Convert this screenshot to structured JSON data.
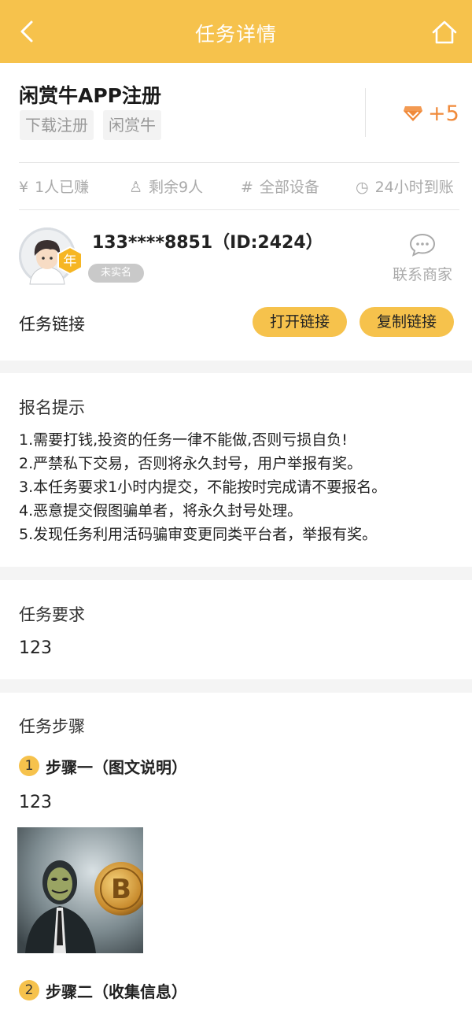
{
  "header": {
    "title": "任务详情",
    "back_icon": "chevron-left-icon",
    "home_icon": "home-icon"
  },
  "task": {
    "title": "闲赏牛APP注册",
    "tags": [
      "下载注册",
      "闲赏牛"
    ],
    "reward": "+5",
    "reward_icon": "gem-icon",
    "stats": [
      {
        "icon": "yen-icon",
        "symbol": "¥",
        "text": "1人已赚"
      },
      {
        "icon": "user-icon",
        "symbol": "♙",
        "text": "剩余9人"
      },
      {
        "icon": "hash-icon",
        "symbol": "#",
        "text": "全部设备"
      },
      {
        "icon": "clock-icon",
        "symbol": "◷",
        "text": "24小时到账"
      }
    ]
  },
  "merchant": {
    "user_line": "133****8851（ID:2424）",
    "badge": "年",
    "realname_status": "未实名",
    "contact_label": "联系商家"
  },
  "task_link": {
    "label": "任务链接",
    "open_button": "打开链接",
    "copy_button": "复制链接"
  },
  "signup_tips": {
    "title": "报名提示",
    "items": [
      "1.需要打钱,投资的任务一律不能做,否则亏损自负!",
      "2.严禁私下交易，否则将永久封号，用户举报有奖。",
      "3.本任务要求1小时内提交，不能按时完成请不要报名。",
      "4.恶意提交假图骗单者，将永久封号处理。",
      "5.发现任务利用活码骗审变更同类平台者，举报有奖。"
    ]
  },
  "requirements": {
    "title": "任务要求",
    "value": "123"
  },
  "steps": {
    "title": "任务步骤",
    "items": [
      {
        "num": "1",
        "title": "步骤一（图文说明）",
        "desc": "123"
      },
      {
        "num": "2",
        "title": "步骤二（收集信息）"
      }
    ]
  },
  "colors": {
    "brand": "#f6c24c",
    "reward": "#f08a3a",
    "muted": "#aaaaaa"
  }
}
